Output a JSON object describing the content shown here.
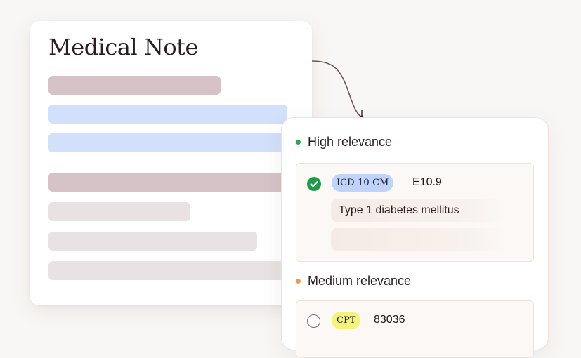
{
  "note": {
    "title": "Medical Note"
  },
  "panel": {
    "high": {
      "label": "High relevance",
      "color": "#2ba84a",
      "item": {
        "checked": true,
        "code_system": "ICD-10-CM",
        "code": "E10.9",
        "description": "Type 1 diabetes mellitus"
      }
    },
    "medium": {
      "label": "Medium relevance",
      "color": "#f39a4b",
      "item": {
        "checked": false,
        "code_system": "CPT",
        "code": "83036"
      }
    }
  },
  "colors": {
    "background": "#f9f7f5",
    "icd_tag": "#bfd3fb",
    "cpt_tag": "#f6f37d",
    "check": "#1d9c48"
  }
}
